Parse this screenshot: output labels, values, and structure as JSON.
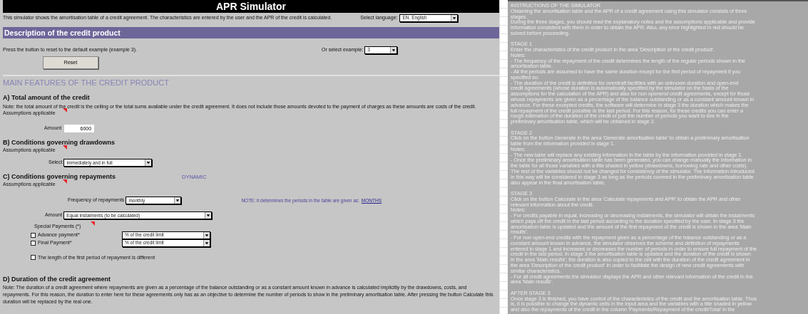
{
  "title": "APR Simulator",
  "intro": "This simulator shows the amortisation table of a credit agreement. The characteristics are entered by the user and the APR of the credit is calculated.",
  "language": {
    "label": "Select language:",
    "value": "EN. English"
  },
  "description_header": "Description of the credit product",
  "reset": {
    "text": "Press the button to reset to the default example (example 3).",
    "button": "Reset"
  },
  "example": {
    "label": "Or select example:",
    "value": "3"
  },
  "main_header": "MAIN FEATURES OF THE CREDIT PRODUCT",
  "total_amount": {
    "heading": "A) Total amount of the credit",
    "note": "Note: the total amount of the credit is the ceiling or the total sums available under the credit agreement. It does not include those amounts devoted to the payment of charges as these amounts are costs of the credit.",
    "assumptions": "Assumptions applicable",
    "field_label": "Amount",
    "value": "6000"
  },
  "drawdowns": {
    "heading": "B) Conditions governing drawdowns",
    "assumptions": "Assumptions applicable",
    "field_label": "Select",
    "value": "immediately and in full"
  },
  "repayments": {
    "heading": "C) Conditions governing repayments",
    "tag": "DYNAMIC",
    "assumptions": "Assumptions applicable",
    "frequency": {
      "label": "Frequency of repayments",
      "value": "monthly"
    },
    "period_note": "NOTE: it determines the periods in the table are given as:",
    "period_link": "MONTHS",
    "amount": {
      "label": "Amount",
      "value": "Equal instalments (to be calculated)"
    },
    "special_label": "Special Payments (*)",
    "special_payments": [
      {
        "label": "Advance payment*",
        "checked": false,
        "value": "% of the credit limit"
      },
      {
        "label": "Final Payment*",
        "checked": false,
        "value": "% of the credit limit"
      }
    ],
    "first_period": {
      "label": "The length of the first period of repayment is different",
      "checked": false
    }
  },
  "duration": {
    "heading": "D) Duration of the credit agreement",
    "note": "Note: The duration of a credit agreement where repayments are given as a percentage of the balance outstanding or as a constant amount known in advance is calculated implicitly by the drawdowns, costs, and repayments. For this reason, the duration to enter here for these agreements only has as an objective to determine the number of periods to show in the preliminary amortisation table. After pressing the button Calculate this duration will be replaced by the real one."
  },
  "instructions": [
    {
      "lines": [
        "INSTRUCTIONS OF THE SIMULATOR",
        "Obtaining the amortisation table and the APR of a credit agreement using this simulator consists of three",
        "stages.",
        "During the three stages, you should read the explanatory notes and the assumptions applicable and provide",
        "information consistent with them in order to obtain the APR. Also, any error highlighted in red should be",
        "solved before proceeding."
      ]
    },
    {
      "lines": [
        "STAGE 1",
        "Enter the characteristics of the credit product in the area 'Description of the credit product'.",
        "Notes:",
        "- The frequency of the repayment of the credit determines the length of the regular periods shown in the",
        "amortisation table.",
        "- All the periods are assumed to have the same duration except for the first period of repayment if you",
        "specified so.",
        "- The duration of the credit is definitive for overdraft facilities with an unknown duration and open-end",
        "credit agreements (whose duration is automatically specified by the simulator on the basis of the",
        "assumptions for the calculation of the APR) and also for non openend credit agreements, except for those",
        "whose repayments are given as a percentage of the balance outstanding or as a constant amount known in",
        "advance. For these excepted credits, the software will determine in stage 3 the duration which makes the",
        "full repayment of the credit possible in the last period. For this reason, for these credits you can enter a",
        "rough estimation of the duration of the credit or just the number of periods you want to see in the",
        "preliminary amortisation table, which will be obtained in stage 2."
      ]
    },
    {
      "lines": [
        "STAGE 2",
        "Click on the button Generate in the area 'Generate amortisation table' to obtain a preliminary amortisation",
        "table from the information provided in stage 1.",
        "Notes:",
        "- The new table will replace any existing information in the table by the information provided in stage 1.",
        "- Once the preliminary amortisation table has been generated, you can change manually the information in",
        "the table for all those variables with a title shaded in yellow (drawdowns, borrowing rate and other costs).",
        "The rest of the variables should not be changed for consistency of the simulator. The information introduced",
        "in this way will be considered in stage 3 as long as the periods covered in the preliminary amortisation table",
        "also appear in the final amortisation table."
      ]
    },
    {
      "lines": [
        "STAGE 3",
        "Click on the button Calculate in the area 'Calculate repayments and APR' to obtain the APR and other",
        "relevant information about the credit.",
        "Notes:",
        "- For credits payable in equal, increasing or decreasing instalments, the simulator will obtain the instalments",
        "which pays off the credit in the last period according to the duration specified by the user. In stage 3 the",
        "amortisation table is updated and the amount of the first repayment of the credit is shown in the area 'Main",
        "results'.",
        "- For non open-end credits with the repayment given as a percentage of the balance outstanding or as a",
        "constant amount known in advance, the simulator observes the scheme and definition of repayments",
        "entered in stage 1 and increases or decreases the number of periods in order to ensure full repayment of the",
        "credit in the last period. In stage 3 the amortisation table is updated and the duration of the credit is shown",
        "in the area 'Main results'; the duration is also copied to the cell with the duration of the credit agreement in",
        "the area 'Description of the credit product' in order to facilitate the design of new credit agreements with",
        "similar characteristics.",
        "- For all credit agreements the simulator displays the APR and other relevant information of the credit in the",
        "area 'Main results'."
      ]
    },
    {
      "lines": [
        "AFTER STAGE 3",
        "Once stage 3 is finished, you have control of the characteristics of the credit and the amortisation table. Thus",
        "is, it is possible to change the dynamic cells in the input area and the variables with a title shaded in yellow",
        "and also the repayments of the credit in the column 'Payments/Repayment of the credit/Total' in the"
      ]
    }
  ]
}
